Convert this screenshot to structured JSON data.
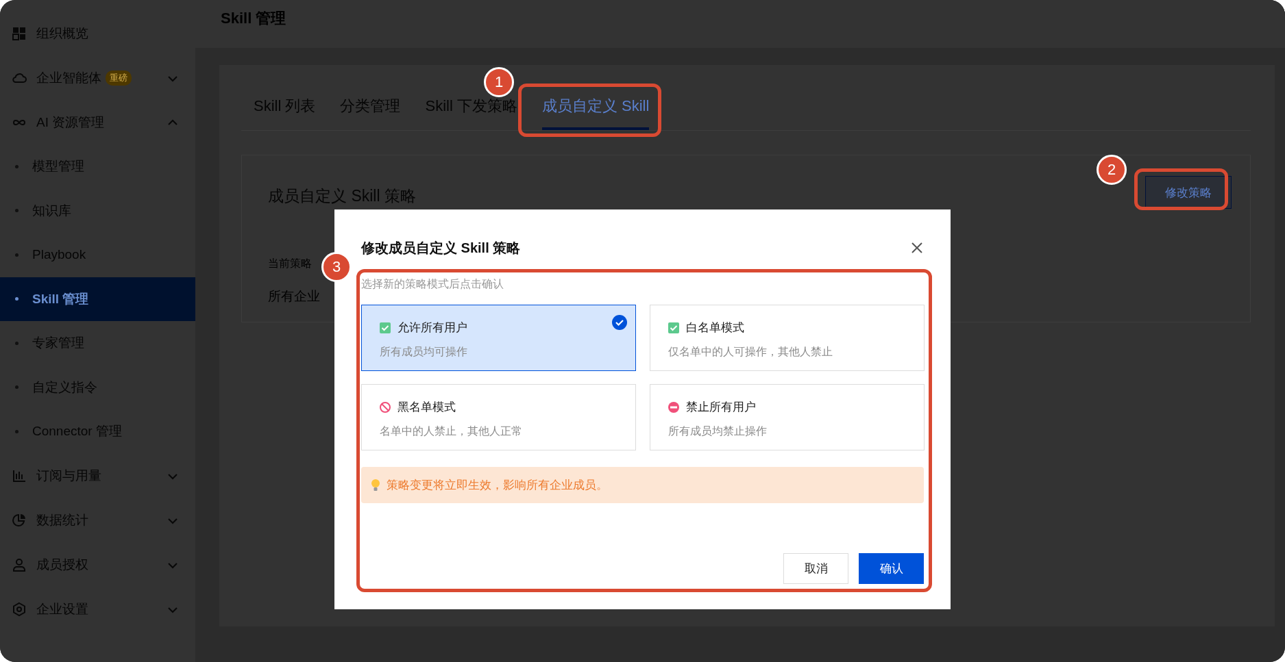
{
  "sidebar": {
    "items": [
      {
        "label": "组织概览"
      },
      {
        "label": "企业智能体",
        "badge": "重磅",
        "expanded": false
      },
      {
        "label": "AI 资源管理",
        "expanded": true,
        "children": [
          {
            "label": "模型管理",
            "selected": false
          },
          {
            "label": "知识库",
            "selected": false
          },
          {
            "label": "Playbook",
            "selected": false
          },
          {
            "label": "Skill 管理",
            "selected": true
          },
          {
            "label": "专家管理",
            "selected": false
          },
          {
            "label": "自定义指令",
            "selected": false
          },
          {
            "label": "Connector 管理",
            "selected": false
          }
        ]
      },
      {
        "label": "订阅与用量",
        "expanded": false
      },
      {
        "label": "数据统计",
        "expanded": false
      },
      {
        "label": "成员授权",
        "expanded": false
      },
      {
        "label": "企业设置",
        "expanded": false
      }
    ]
  },
  "header": {
    "title": "Skill 管理"
  },
  "tabs": [
    {
      "label": "Skill 列表",
      "selected": false
    },
    {
      "label": "分类管理",
      "selected": false
    },
    {
      "label": "Skill 下发策略",
      "selected": false
    },
    {
      "label": "成员自定义 Skill",
      "selected": true
    }
  ],
  "policy_card": {
    "title": "成员自定义 Skill 策略",
    "button": "修改策略",
    "current_label": "当前策略",
    "current_value": "所有企业"
  },
  "modal": {
    "title": "修改成员自定义 Skill 策略",
    "hint": "选择新的策略模式后点击确认",
    "options": [
      {
        "kind": "allow",
        "title": "允许所有用户",
        "description": "所有成员均可操作",
        "selected": true
      },
      {
        "kind": "allow",
        "title": "白名单模式",
        "description": "仅名单中的人可操作，其他人禁止",
        "selected": false
      },
      {
        "kind": "ban",
        "title": "黑名单模式",
        "description": "名单中的人禁止，其他人正常",
        "selected": false
      },
      {
        "kind": "deny",
        "title": "禁止所有用户",
        "description": "所有成员均禁止操作",
        "selected": false
      }
    ],
    "notice": "策略变更将立即生效，影响所有企业成员。",
    "buttons": [
      {
        "label": "取消",
        "kind": "secondary"
      },
      {
        "label": "确认",
        "kind": "primary"
      }
    ]
  },
  "annotations": [
    {
      "label": "1"
    },
    {
      "label": "2"
    },
    {
      "label": "3"
    }
  ]
}
